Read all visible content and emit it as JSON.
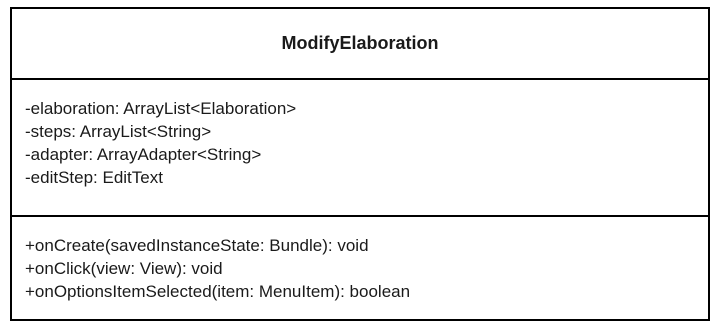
{
  "uml_class": {
    "name": "ModifyElaboration",
    "attributes": [
      "-elaboration: ArrayList<Elaboration>",
      "-steps: ArrayList<String>",
      "-adapter: ArrayAdapter<String>",
      "-editStep: EditText"
    ],
    "methods": [
      "+onCreate(savedInstanceState: Bundle): void",
      "+onClick(view: View): void",
      "+onOptionsItemSelected(item: MenuItem): boolean"
    ]
  }
}
